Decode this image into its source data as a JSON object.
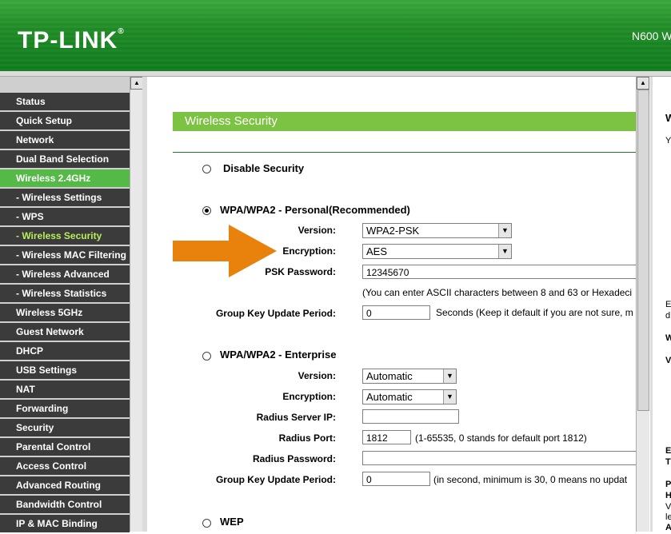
{
  "header": {
    "logo": "TP-LINK",
    "logo_mark": "®",
    "model": "N600 W"
  },
  "sidebar": {
    "items": [
      {
        "label": "Status"
      },
      {
        "label": "Quick Setup"
      },
      {
        "label": "Network"
      },
      {
        "label": "Dual Band Selection"
      },
      {
        "label": "Wireless 2.4GHz"
      },
      {
        "label": "- Wireless Settings"
      },
      {
        "label": "- WPS"
      },
      {
        "label": "- Wireless Security"
      },
      {
        "label": "- Wireless MAC Filtering"
      },
      {
        "label": "- Wireless Advanced"
      },
      {
        "label": "- Wireless Statistics"
      },
      {
        "label": "Wireless 5GHz"
      },
      {
        "label": "Guest Network"
      },
      {
        "label": "DHCP"
      },
      {
        "label": "USB Settings"
      },
      {
        "label": "NAT"
      },
      {
        "label": "Forwarding"
      },
      {
        "label": "Security"
      },
      {
        "label": "Parental Control"
      },
      {
        "label": "Access Control"
      },
      {
        "label": "Advanced Routing"
      },
      {
        "label": "Bandwidth Control"
      },
      {
        "label": "IP & MAC Binding"
      }
    ]
  },
  "main": {
    "title": "Wireless Security",
    "disable": {
      "label": "Disable Security"
    },
    "personal": {
      "label": "WPA/WPA2 - Personal(Recommended)",
      "version_label": "Version:",
      "version_value": "WPA2-PSK",
      "encryption_label": "Encryption:",
      "encryption_value": "AES",
      "psk_label": "PSK Password:",
      "psk_value": "12345670",
      "psk_note": "(You can enter ASCII characters between 8 and 63 or Hexadeci",
      "group_label": "Group Key Update Period:",
      "group_value": "0",
      "group_note": "Seconds (Keep it default if you are not sure, m"
    },
    "enterprise": {
      "label": "WPA/WPA2 - Enterprise",
      "version_label": "Version:",
      "version_value": "Automatic",
      "encryption_label": "Encryption:",
      "encryption_value": "Automatic",
      "radius_ip_label": "Radius Server IP:",
      "radius_ip_value": "",
      "radius_port_label": "Radius Port:",
      "radius_port_value": "1812",
      "radius_port_note": "(1-65535, 0 stands for default port 1812)",
      "radius_pw_label": "Radius Password:",
      "radius_pw_value": "",
      "group_label": "Group Key Update Period:",
      "group_value": "0",
      "group_note": "(in second, minimum is 30, 0 means no updat"
    },
    "wep": {
      "label": "WEP"
    }
  },
  "right_panel": {
    "t1": "W",
    "t2": "Y",
    "t3": "E",
    "t4": "d",
    "t5": "W",
    "t6": "V",
    "t7": "E",
    "t8": "T",
    "t9": "P",
    "t10": "H",
    "t11": "V",
    "t12": "le",
    "t13": "A"
  },
  "colors": {
    "header_green": "#1f8a25",
    "active_green": "#55b948",
    "title_green": "#7cc243",
    "menu_dark": "#3b3b3b",
    "current_text": "#b8ef5a",
    "arrow_orange": "#e8820c"
  }
}
